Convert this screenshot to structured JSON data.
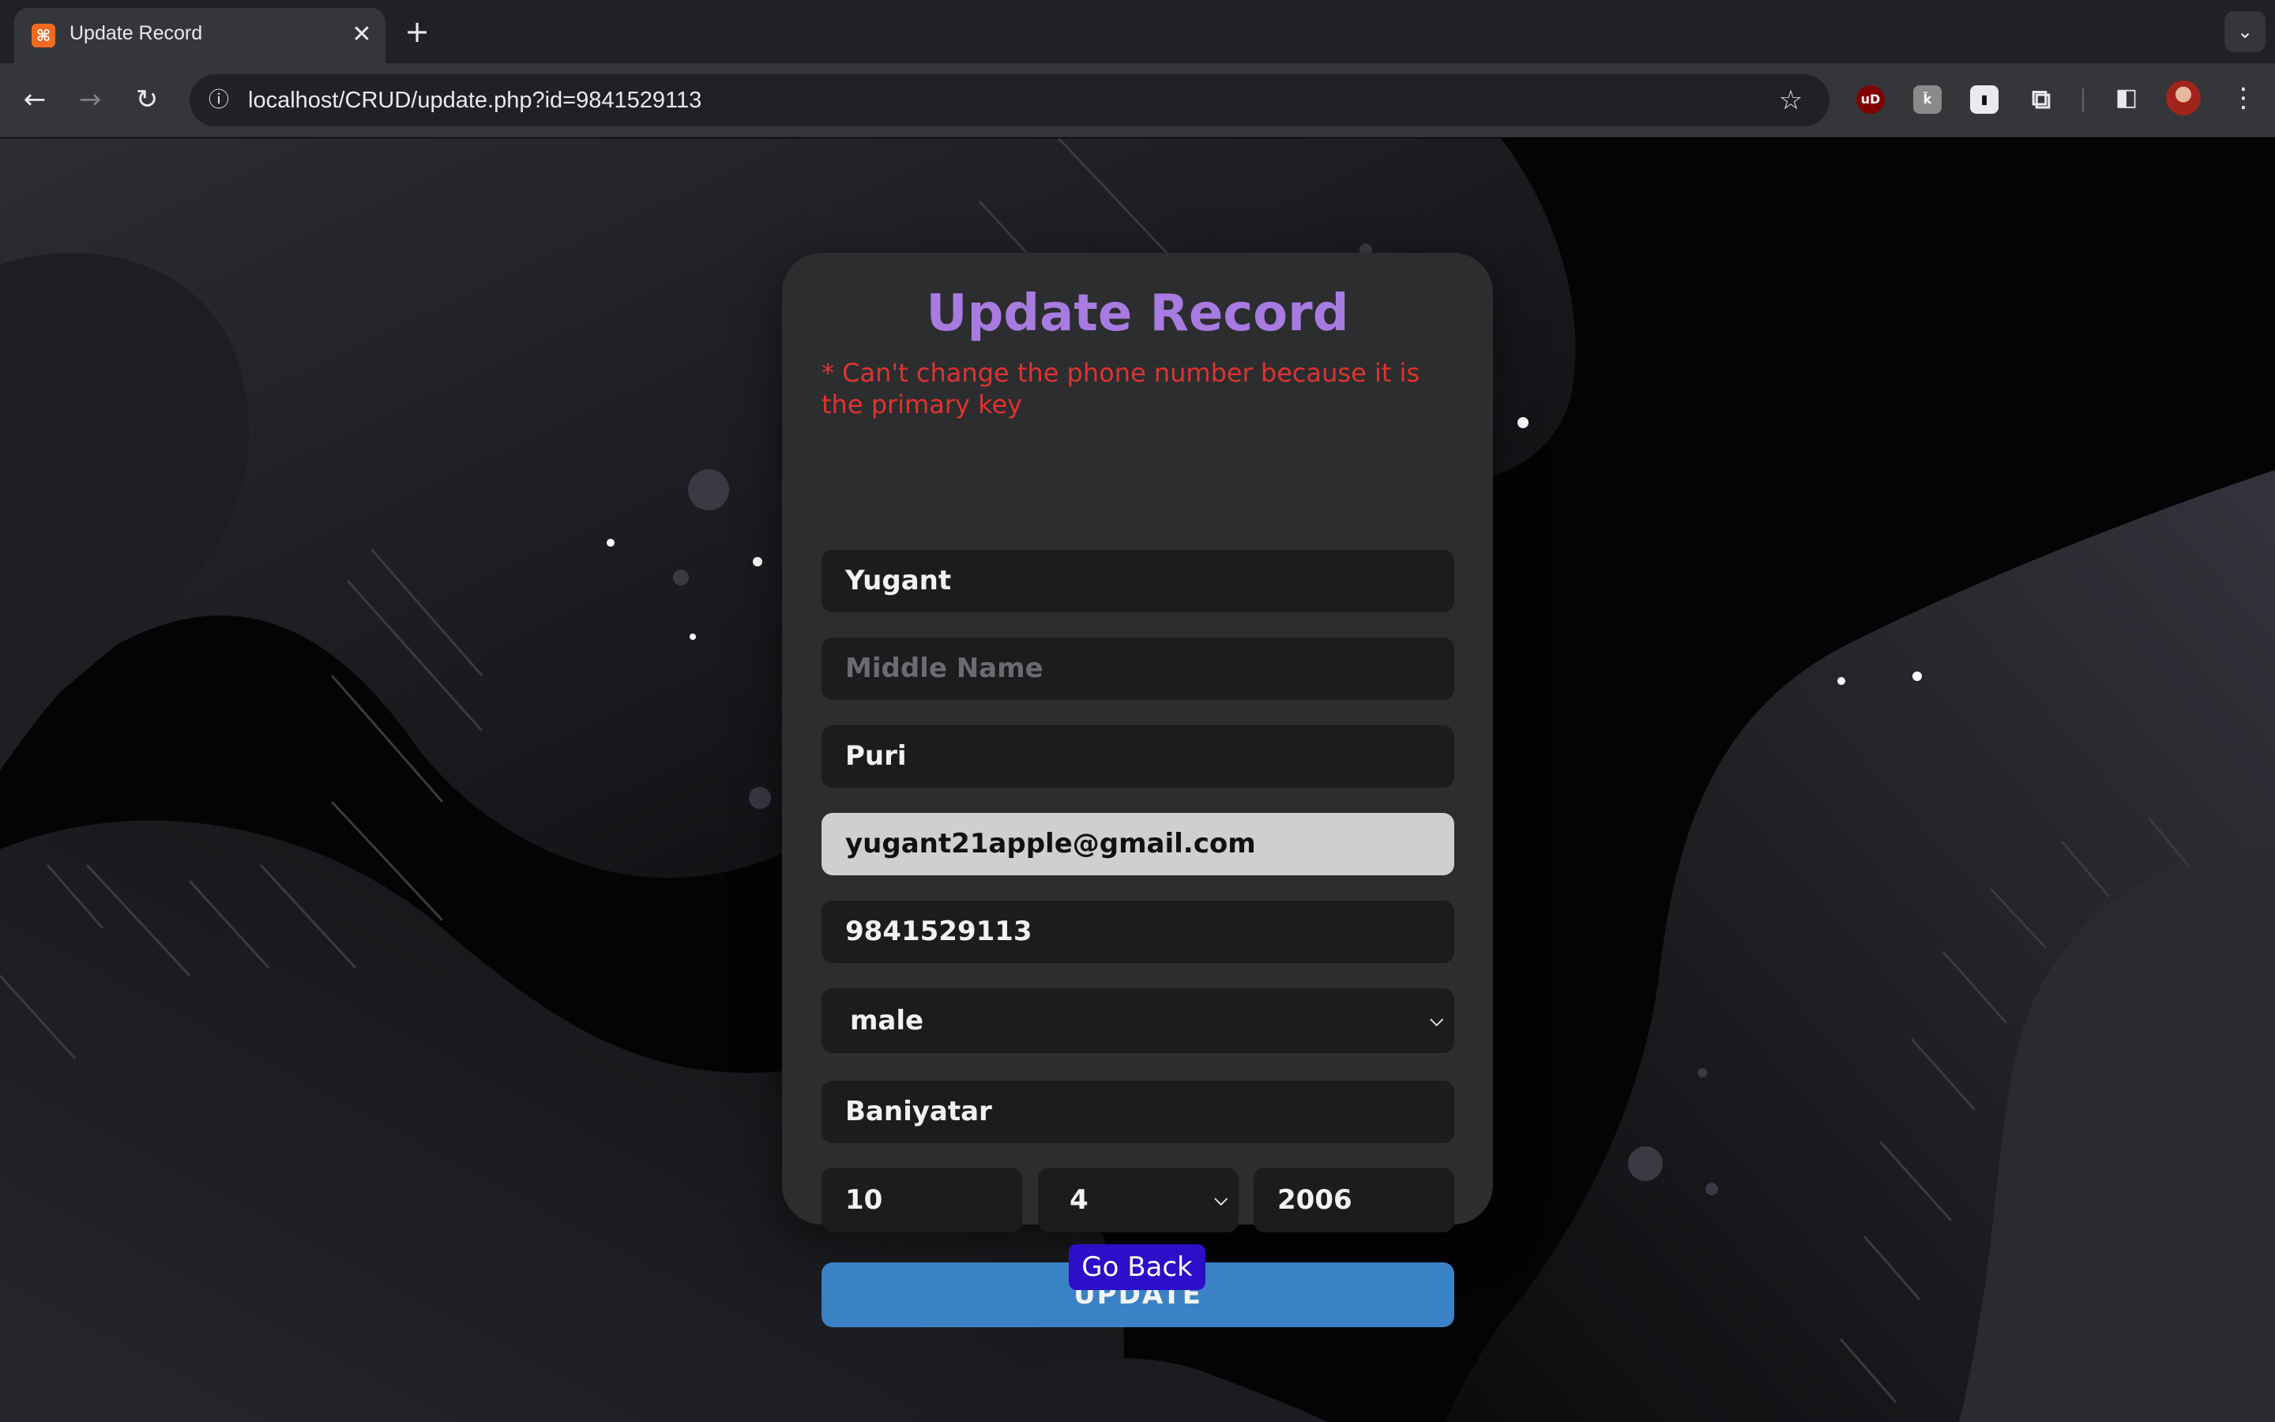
{
  "browser": {
    "tab_title": "Update Record",
    "tab_favicon": "xampp-icon",
    "url": "localhost/CRUD/update.php?id=9841529113"
  },
  "icons": {
    "close": "✕",
    "new_tab": "+",
    "tab_search": "⌄",
    "back": "←",
    "forward": "→",
    "reload": "↻",
    "site_info": "ⓘ",
    "bookmark": "☆",
    "ublock": "uD",
    "ext_gray": "ǩ",
    "ext_black": "▮",
    "extensions": "⧉",
    "sidepanel": "◧",
    "menu": "⋮",
    "chevron": "⌵"
  },
  "form": {
    "title": "Update Record",
    "warning": "* Can't change the phone number because it is the primary key",
    "first_name": "Yugant",
    "middle_name_placeholder": "Middle Name",
    "middle_name": "",
    "last_name": "Puri",
    "email": "yugant21apple@gmail.com",
    "phone": "9841529113",
    "gender": "male",
    "address": "Baniyatar",
    "dob_day": "10",
    "dob_month": "4",
    "dob_year": "2006",
    "update_label": "UPDATE",
    "go_back_label": "Go Back"
  },
  "colors": {
    "title": "#a77be0",
    "warning": "#e0332f",
    "update_button": "#3b82c4",
    "go_back_button": "#2d0ec9"
  }
}
